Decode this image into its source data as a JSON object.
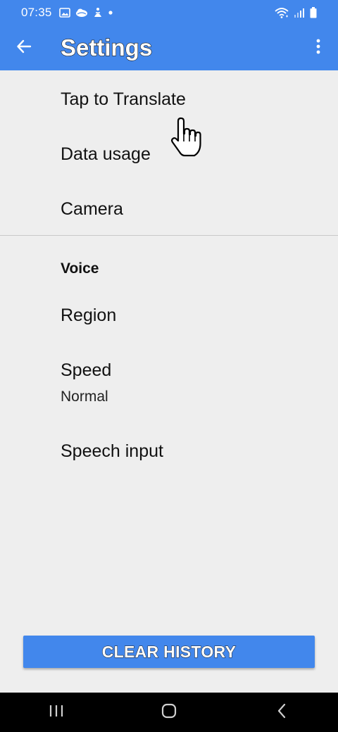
{
  "status_bar": {
    "time": "07:35",
    "left_icons": [
      "image-icon",
      "cloud-icon",
      "accessibility-icon",
      "dot-icon"
    ],
    "right_icons": [
      "wifi-icon",
      "signal-icon",
      "battery-icon"
    ]
  },
  "app_bar": {
    "title": "Settings",
    "back_icon": "arrow-left-icon",
    "overflow_icon": "more-vertical-icon"
  },
  "settings": {
    "items": [
      {
        "title": "Tap to Translate"
      },
      {
        "title": "Data usage"
      },
      {
        "title": "Camera"
      }
    ],
    "voice_section": {
      "header": "Voice",
      "items": [
        {
          "title": "Region"
        },
        {
          "title": "Speed",
          "subtitle": "Normal"
        },
        {
          "title": "Speech input"
        }
      ]
    }
  },
  "clear_history": {
    "label": "CLEAR HISTORY"
  },
  "nav_bar": {
    "buttons": [
      "recent-apps-icon",
      "home-icon",
      "back-nav-icon"
    ]
  },
  "colors": {
    "primary": "#4287ec",
    "background": "#eeeeee",
    "nav_bar": "#000000"
  }
}
